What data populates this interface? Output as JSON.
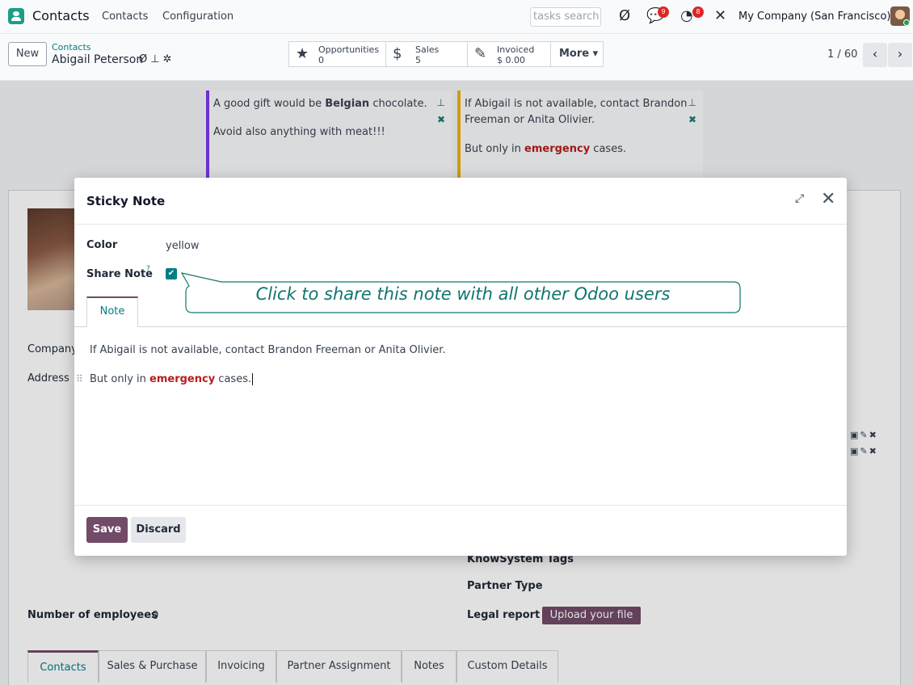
{
  "navbar": {
    "app_title": "Contacts",
    "menu": [
      "Contacts",
      "Configuration"
    ],
    "search_text": "tasks search",
    "messages_count": "9",
    "activities_count": "8",
    "company": "My Company (San Francisco)"
  },
  "control": {
    "new_label": "New",
    "breadcrumb_parent": "Contacts",
    "breadcrumb_current": "Abigail Peterson",
    "smart_buttons": [
      {
        "label": "Opportunities",
        "value": "0"
      },
      {
        "label": "Sales",
        "value": "5"
      },
      {
        "label": "Invoiced",
        "value": "$ 0.00"
      }
    ],
    "more_label": "More ▾",
    "pager": "1 / 60"
  },
  "sticky_notes": [
    {
      "line1_pre": "A good gift would be ",
      "line1_bold": "Belgian",
      "line1_post": " chocolate.",
      "line2": "Avoid also anything with meat!!!"
    },
    {
      "line1": "If Abigail is not available, contact Brandon",
      "line2": "Freeman or Anita Olivier.",
      "line3_pre": "But only in ",
      "line3_bold": "emergency",
      "line3_post": " cases."
    }
  ],
  "form_bg": {
    "company_label": "Company",
    "address_label": "Address",
    "knowsystem_tags_label": "KnowSystem Tags",
    "partner_type_label": "Partner Type",
    "legal_report_label": "Legal report",
    "upload_label": "Upload your file",
    "employees_label": "Number of employees",
    "employees_value": "0",
    "tabs": [
      "Contacts",
      "Sales & Purchase",
      "Invoicing",
      "Partner Assignment",
      "Notes",
      "Custom Details"
    ]
  },
  "dialog": {
    "title": "Sticky Note",
    "color_label": "Color",
    "color_value": "yellow",
    "share_label": "Share Note",
    "share_help": "?",
    "share_checked": true,
    "tab_label": "Note",
    "note_line1": "If Abigail is not available, contact Brandon Freeman or Anita Olivier.",
    "note_line2_pre": "But only in ",
    "note_line2_bold": "emergency",
    "note_line2_post": " cases.",
    "save_label": "Save",
    "discard_label": "Discard"
  },
  "tooltip": {
    "text": "Click to share this note with all other Odoo users"
  },
  "colors": {
    "primary": "#714b67",
    "teal": "#017e84",
    "emphasis": "#b91c1c"
  }
}
